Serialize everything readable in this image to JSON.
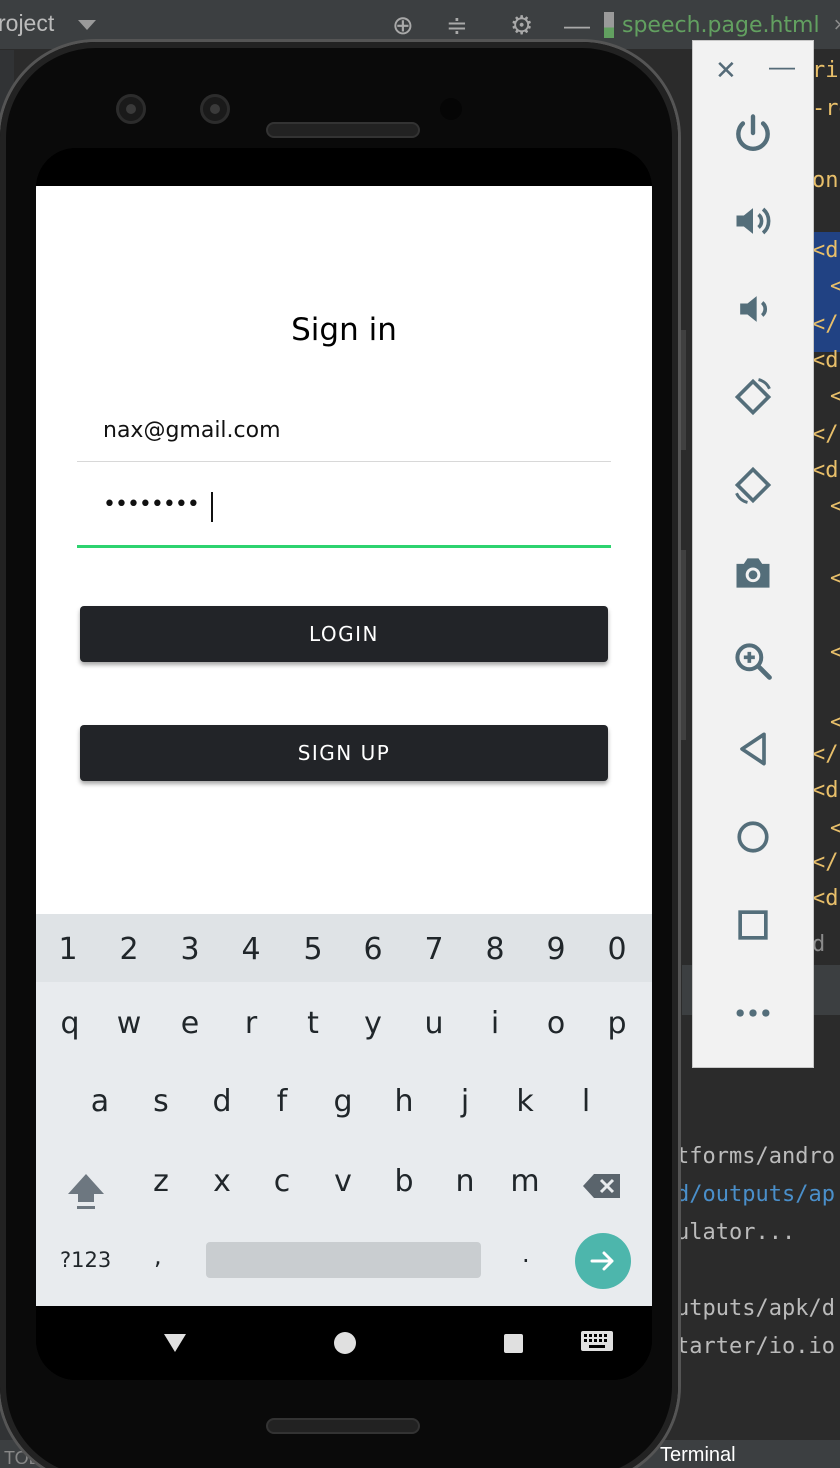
{
  "ide": {
    "project_label": "roject",
    "file_tab": "speech.page.html",
    "code_lines": [
      "ric",
      "-re",
      "on-",
      "<di",
      "<",
      "</c",
      "<di",
      "<",
      "</c",
      "<di",
      "<",
      "<",
      "<",
      "<",
      "</c",
      "<di",
      "<",
      "</c",
      "<di"
    ],
    "editor_status": "d",
    "terminal_lines": [
      "tforms/andro",
      "d/outputs/ap",
      "ulator...",
      "",
      "utputs/apk/d",
      "tarter/io.io"
    ],
    "terminal_tab": "Terminal",
    "todo_tab": "TOD"
  },
  "emulator_panel": {
    "close_icon": "close-icon",
    "minimize_icon": "minimize-icon",
    "buttons": [
      "power-icon",
      "volume-up-icon",
      "volume-down-icon",
      "rotate-left-icon",
      "rotate-right-icon",
      "camera-icon",
      "zoom-icon",
      "back-icon",
      "home-icon",
      "overview-icon",
      "more-icon"
    ],
    "icon_color": "#546e7a"
  },
  "app": {
    "title": "Sign in",
    "email_value": "nax@gmail.com",
    "password_value": "••••••••",
    "login_label": "LOGIN",
    "signup_label": "SIGN UP",
    "accent_color": "#2dd36f",
    "button_color": "#222428"
  },
  "keyboard": {
    "number_row": [
      "1",
      "2",
      "3",
      "4",
      "5",
      "6",
      "7",
      "8",
      "9",
      "0"
    ],
    "row1": [
      "q",
      "w",
      "e",
      "r",
      "t",
      "y",
      "u",
      "i",
      "o",
      "p"
    ],
    "row2": [
      "a",
      "s",
      "d",
      "f",
      "g",
      "h",
      "j",
      "k",
      "l"
    ],
    "row3": [
      "z",
      "x",
      "c",
      "v",
      "b",
      "n",
      "m"
    ],
    "symbols_label": "?123",
    "comma_label": ",",
    "period_label": ".",
    "enter_color": "#4db6ac"
  }
}
